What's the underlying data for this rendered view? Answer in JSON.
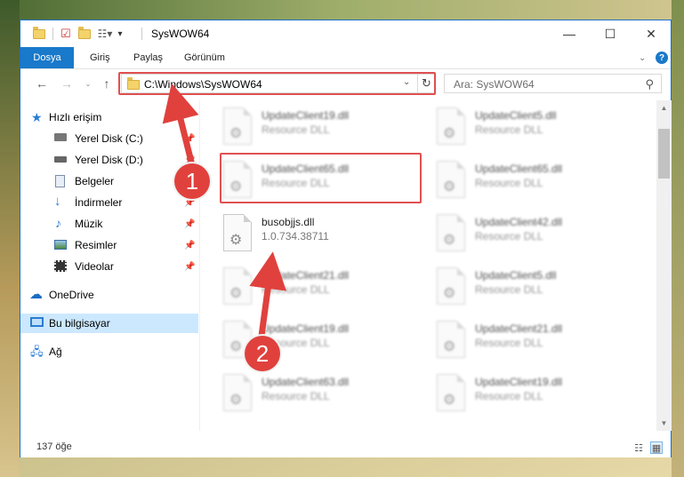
{
  "window": {
    "title": "SysWOW64",
    "minimize_glyph": "—",
    "maximize_glyph": "☐",
    "close_glyph": "✕"
  },
  "ribbon": {
    "tabs": [
      {
        "label": "Dosya",
        "active": true
      },
      {
        "label": "Giriş"
      },
      {
        "label": "Paylaş"
      },
      {
        "label": "Görünüm"
      }
    ]
  },
  "address": {
    "path": "C:\\Windows\\SysWOW64",
    "search_placeholder": "Ara: SysWOW64"
  },
  "sidebar": {
    "items": [
      {
        "label": "Hızlı erişim",
        "icon": "star-icon"
      },
      {
        "label": "Yerel Disk (C:)",
        "icon": "drive-icon"
      },
      {
        "label": "Yerel Disk (D:)",
        "icon": "drive-icon"
      },
      {
        "label": "Belgeler",
        "icon": "document-icon"
      },
      {
        "label": "İndirmeler",
        "icon": "download-icon"
      },
      {
        "label": "Müzik",
        "icon": "music-icon"
      },
      {
        "label": "Resimler",
        "icon": "pictures-icon"
      },
      {
        "label": "Videolar",
        "icon": "video-icon"
      },
      {
        "label": "OneDrive",
        "icon": "cloud-icon"
      },
      {
        "label": "Bu bilgisayar",
        "icon": "computer-icon",
        "selected": true
      },
      {
        "label": "Ağ",
        "icon": "network-icon"
      }
    ]
  },
  "files": [
    {
      "name": "UpdateClient19.dll",
      "sub": "Resource DLL"
    },
    {
      "name": "UpdateClient5.dll",
      "sub": "Resource DLL"
    },
    {
      "name": "UpdateClient65.dll",
      "sub": "Resource DLL"
    },
    {
      "name": "UpdateClient65.dll",
      "sub": "Resource DLL"
    },
    {
      "name": "busobjjs.dll",
      "sub": "1.0.734.38711"
    },
    {
      "name": "UpdateClient42.dll",
      "sub": "Resource DLL"
    },
    {
      "name": "UpdateClient21.dll",
      "sub": "Resource DLL"
    },
    {
      "name": "UpdateClient5.dll",
      "sub": "Resource DLL"
    },
    {
      "name": "UpdateClient19.dll",
      "sub": "Resource DLL"
    },
    {
      "name": "UpdateClient21.dll",
      "sub": "Resource DLL"
    },
    {
      "name": "UpdateClient63.dll",
      "sub": "Resource DLL"
    },
    {
      "name": "UpdateClient19.dll",
      "sub": "Resource DLL"
    }
  ],
  "status": {
    "item_count": "137 öğe"
  },
  "callouts": {
    "one": "1",
    "two": "2"
  },
  "colors": {
    "accent": "#1979ca",
    "highlight": "#e05050",
    "selection": "#cce8ff"
  }
}
